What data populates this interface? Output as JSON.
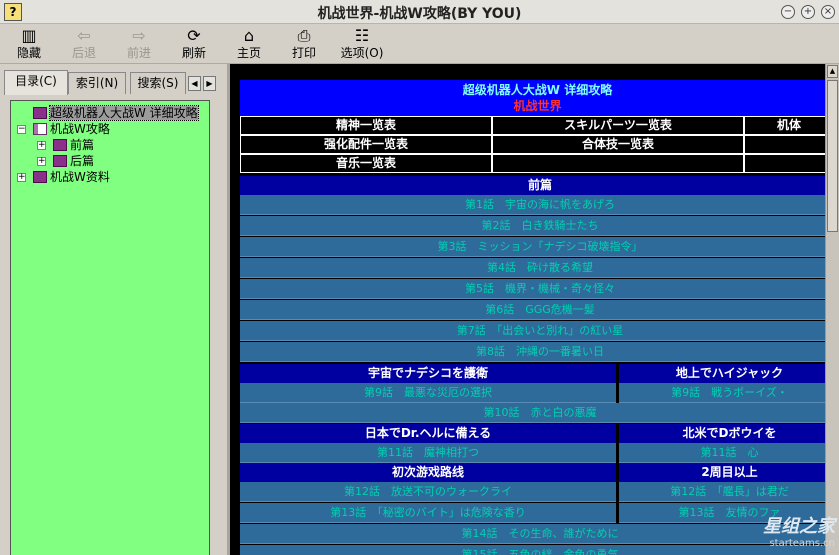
{
  "window": {
    "title": "机战世界-机战W攻略(BY YOU)",
    "icon": "help-icon"
  },
  "toolbar": {
    "hide": "隐藏",
    "back": "后退",
    "forward": "前进",
    "refresh": "刷新",
    "home": "主页",
    "print": "打印",
    "options": "选项(O)"
  },
  "tabs": {
    "contents": "目录(C)",
    "index": "索引(N)",
    "search": "搜索(S)"
  },
  "tree": {
    "root": "超级机器人大战W 详细攻略",
    "strategy": "机战W攻略",
    "part1": "前篇",
    "part2": "后篇",
    "data": "机战W资料"
  },
  "content": {
    "title": "超级机器人大战W 详细攻略",
    "subtitle": "机战世界",
    "links": {
      "spirit": "精神一览表",
      "skill": "スキルパーツ一览表",
      "mech": "机体",
      "upgrade": "强化配件一览表",
      "combo": "合体技一览表",
      "music": "音乐一览表"
    },
    "part1_header": "前篇",
    "ep1": "第1話　宇宙の海に帆をあげろ",
    "ep2": "第2話　白き鉄騎士たち",
    "ep3": "第3話　ミッション「ナデシコ破壊指令」",
    "ep4": "第4話　砕け散る希望",
    "ep5": "第5話　機界・機械・奇々怪々",
    "ep6": "第6話　GGG危機一髪",
    "ep7": "第7話　「出会いと別れ」の紅い星",
    "ep8": "第8話　沖縄の一番暑い日",
    "route_space": "宇宙でナデシコを護衛",
    "route_ground": "地上でハイジャック",
    "ep9a": "第9話　最悪な災厄の選択",
    "ep9b": "第9話　戦うボーイズ・",
    "ep10": "第10話　赤と白の悪魔",
    "route_japan": "日本でDr.ヘルに備える",
    "route_na": "北米でDボウイを",
    "ep11a": "第11話　魔神相打つ",
    "ep11b": "第11話　心",
    "route_first": "初次游戏路线",
    "route_second": "2周目以上",
    "ep12a": "第12話　放送不可のウォークライ",
    "ep12b": "第12話　「艦長」は君だ",
    "ep13a": "第13話　「秘密のバイト」は危険な香り",
    "ep13b": "第13話　友情のファ",
    "ep14": "第14話　その生命、誰がために",
    "ep15": "第15話　五色の絆、金色の勇気"
  },
  "watermark": {
    "brand": "星组之家",
    "url": "starteams.cn"
  }
}
